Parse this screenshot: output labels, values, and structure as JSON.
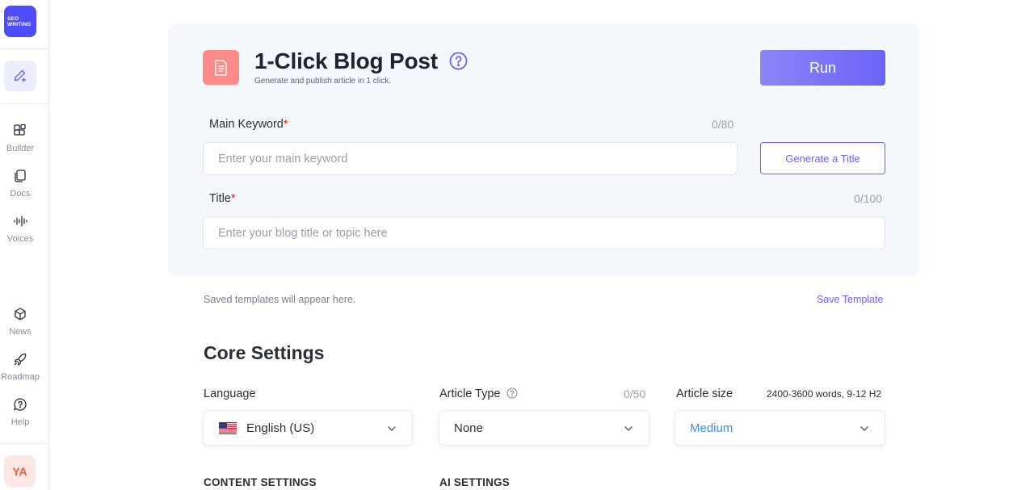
{
  "sidebar": {
    "logo_line1": "SEO",
    "logo_line2": "WRITING",
    "items": [
      {
        "label": "Builder"
      },
      {
        "label": "Docs"
      },
      {
        "label": "Voices"
      },
      {
        "label": "News"
      },
      {
        "label": "Roadmap"
      },
      {
        "label": "Help"
      }
    ],
    "avatar_initials": "YA"
  },
  "header": {
    "title": "1-Click Blog Post",
    "subtitle": "Generate and publish article in 1 click.",
    "run_label": "Run"
  },
  "form": {
    "keyword_label": "Main Keyword",
    "keyword_counter": "0/80",
    "keyword_placeholder": "Enter your main keyword",
    "generate_title_label": "Generate a Title",
    "title_label": "Title",
    "title_counter": "0/100",
    "title_placeholder": "Enter your blog title or topic here",
    "required_mark": "*"
  },
  "templates": {
    "empty_text": "Saved templates will appear here.",
    "save_label": "Save Template"
  },
  "core": {
    "title": "Core Settings",
    "language_label": "Language",
    "language_value": "English (US)",
    "article_type_label": "Article Type",
    "article_type_counter": "0/50",
    "article_type_value": "None",
    "article_size_label": "Article size",
    "article_size_meta": "2400-3600 words, 9-12 H2",
    "article_size_value": "Medium"
  },
  "sections": {
    "content_settings": "CONTENT SETTINGS",
    "ai_settings": "AI SETTINGS"
  },
  "colors": {
    "accent": "#6c63f5",
    "logo_bg": "#4d4dff",
    "doc_icon_bg": "#ff8a8a",
    "medium_text": "#3f8fe0"
  }
}
